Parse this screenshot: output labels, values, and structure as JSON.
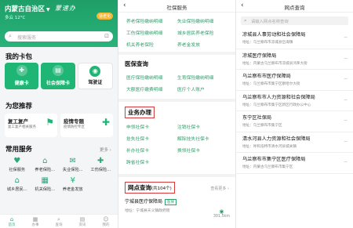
{
  "panel1": {
    "region": "内蒙古自治区",
    "calligraphy": "蒙速办",
    "weather": "多云 12°C",
    "age_badge": "适老化",
    "search_placeholder": "搜索服务",
    "my_cards_title": "我的卡包",
    "cards": [
      {
        "label": "健康卡",
        "icon": "health-card-icon",
        "glyph": "✚"
      },
      {
        "label": "社会保障卡",
        "icon": "social-security-card-icon",
        "glyph": "▤"
      },
      {
        "label": "驾驶证",
        "icon": "driver-license-icon",
        "glyph": "◉"
      }
    ],
    "recommend_title": "为您推荐",
    "recommendations": [
      {
        "title": "复工复产",
        "subtitle": "复工复产相关服务",
        "glyph": "⚑"
      },
      {
        "title": "疫情专题",
        "subtitle": "疫情防控专区",
        "glyph": "✚"
      }
    ],
    "services_title": "常用服务",
    "more_label": "更多 ›",
    "services": [
      {
        "label": "社保服务",
        "icon": "social-security-icon",
        "glyph": "♥"
      },
      {
        "label": "养老保险...",
        "icon": "pension-icon",
        "glyph": "⌂"
      },
      {
        "label": "失业保险...",
        "icon": "unemployment-icon",
        "glyph": "✉"
      },
      {
        "label": "工伤保险...",
        "icon": "injury-insurance-icon",
        "glyph": "✚"
      },
      {
        "label": "城乡居民...",
        "icon": "residents-icon",
        "glyph": "⌂"
      },
      {
        "label": "机关保险...",
        "icon": "institution-icon",
        "glyph": "▦"
      },
      {
        "label": "养老金发放",
        "icon": "pension-payout-icon",
        "glyph": "¥"
      }
    ],
    "tabs": [
      {
        "label": "首页",
        "icon": "home-icon",
        "glyph": "⌂",
        "active": true
      },
      {
        "label": "办事",
        "icon": "service-icon",
        "glyph": "▦",
        "active": false
      },
      {
        "label": "查询",
        "icon": "query-icon",
        "glyph": "⌕",
        "active": false
      },
      {
        "label": "资讯",
        "icon": "news-icon",
        "glyph": "▤",
        "active": false
      },
      {
        "label": "我的",
        "icon": "profile-icon",
        "glyph": "☺",
        "active": false
      }
    ]
  },
  "panel2": {
    "title": "社保服务",
    "top_links": [
      "养老保险缴纳明细",
      "失业保险缴纳明细",
      "工伤保险缴纳明细",
      "城乡居民养老保险",
      "机关养老保险",
      "养老金发放"
    ],
    "medical_title": "医保查询",
    "medical_links": [
      "医疗保险缴纳明细",
      "生育保险缴纳明细",
      "大额医疗缴费明细",
      "医疗个人账户"
    ],
    "business_title": "业务办理",
    "business_links": [
      "申领社保卡",
      "注销社保卡",
      "挂失社保卡",
      "解除挂失社保卡",
      "补办社保卡",
      "换领社保卡",
      "跨省社保卡"
    ],
    "outlet_title": "网点查询",
    "outlet_count": "(共104个)",
    "outlet_more": "查看更多 ›",
    "outlet": {
      "name": "宁城县医疗保障局",
      "tag": "医保",
      "address": "地址：宁城县天义镇政府街",
      "distance": "301.5km"
    }
  },
  "panel3": {
    "title": "网点查询",
    "search_placeholder": "请输入网点名称查询",
    "outlets": [
      {
        "name": "凉城县人事劳动和社会保障局",
        "address": "地址：乌兰察布市凉城县岱海镇",
        "distance": "—"
      },
      {
        "name": "凉城医疗保障局",
        "address": "地址：内蒙古乌兰察布市凉城县鸿茅大街",
        "distance": "—"
      },
      {
        "name": "乌兰察布市医疗保障局",
        "address": "地址：乌兰察布市集宁区察哈尔大街",
        "distance": "—"
      },
      {
        "name": "乌兰察布市人力资源和社会保障局",
        "address": "地址：乌兰察布市集宁区新区行政办公中心",
        "distance": "—"
      },
      {
        "name": "东宁区社保局",
        "address": "地址：乌兰察布市集宁区",
        "distance": "—"
      },
      {
        "name": "清水河县人力资源和社会保障局",
        "address": "地址：呼和浩特市清水河县城关镇",
        "distance": "—"
      },
      {
        "name": "乌兰察布市集宁区医疗保障局",
        "address": "地址：内蒙古乌兰察布市集宁区",
        "distance": "—"
      }
    ]
  },
  "colors": {
    "brand_green": "#1fb574",
    "link_green": "#2f9e6b",
    "highlight_red": "#d83a3a"
  }
}
